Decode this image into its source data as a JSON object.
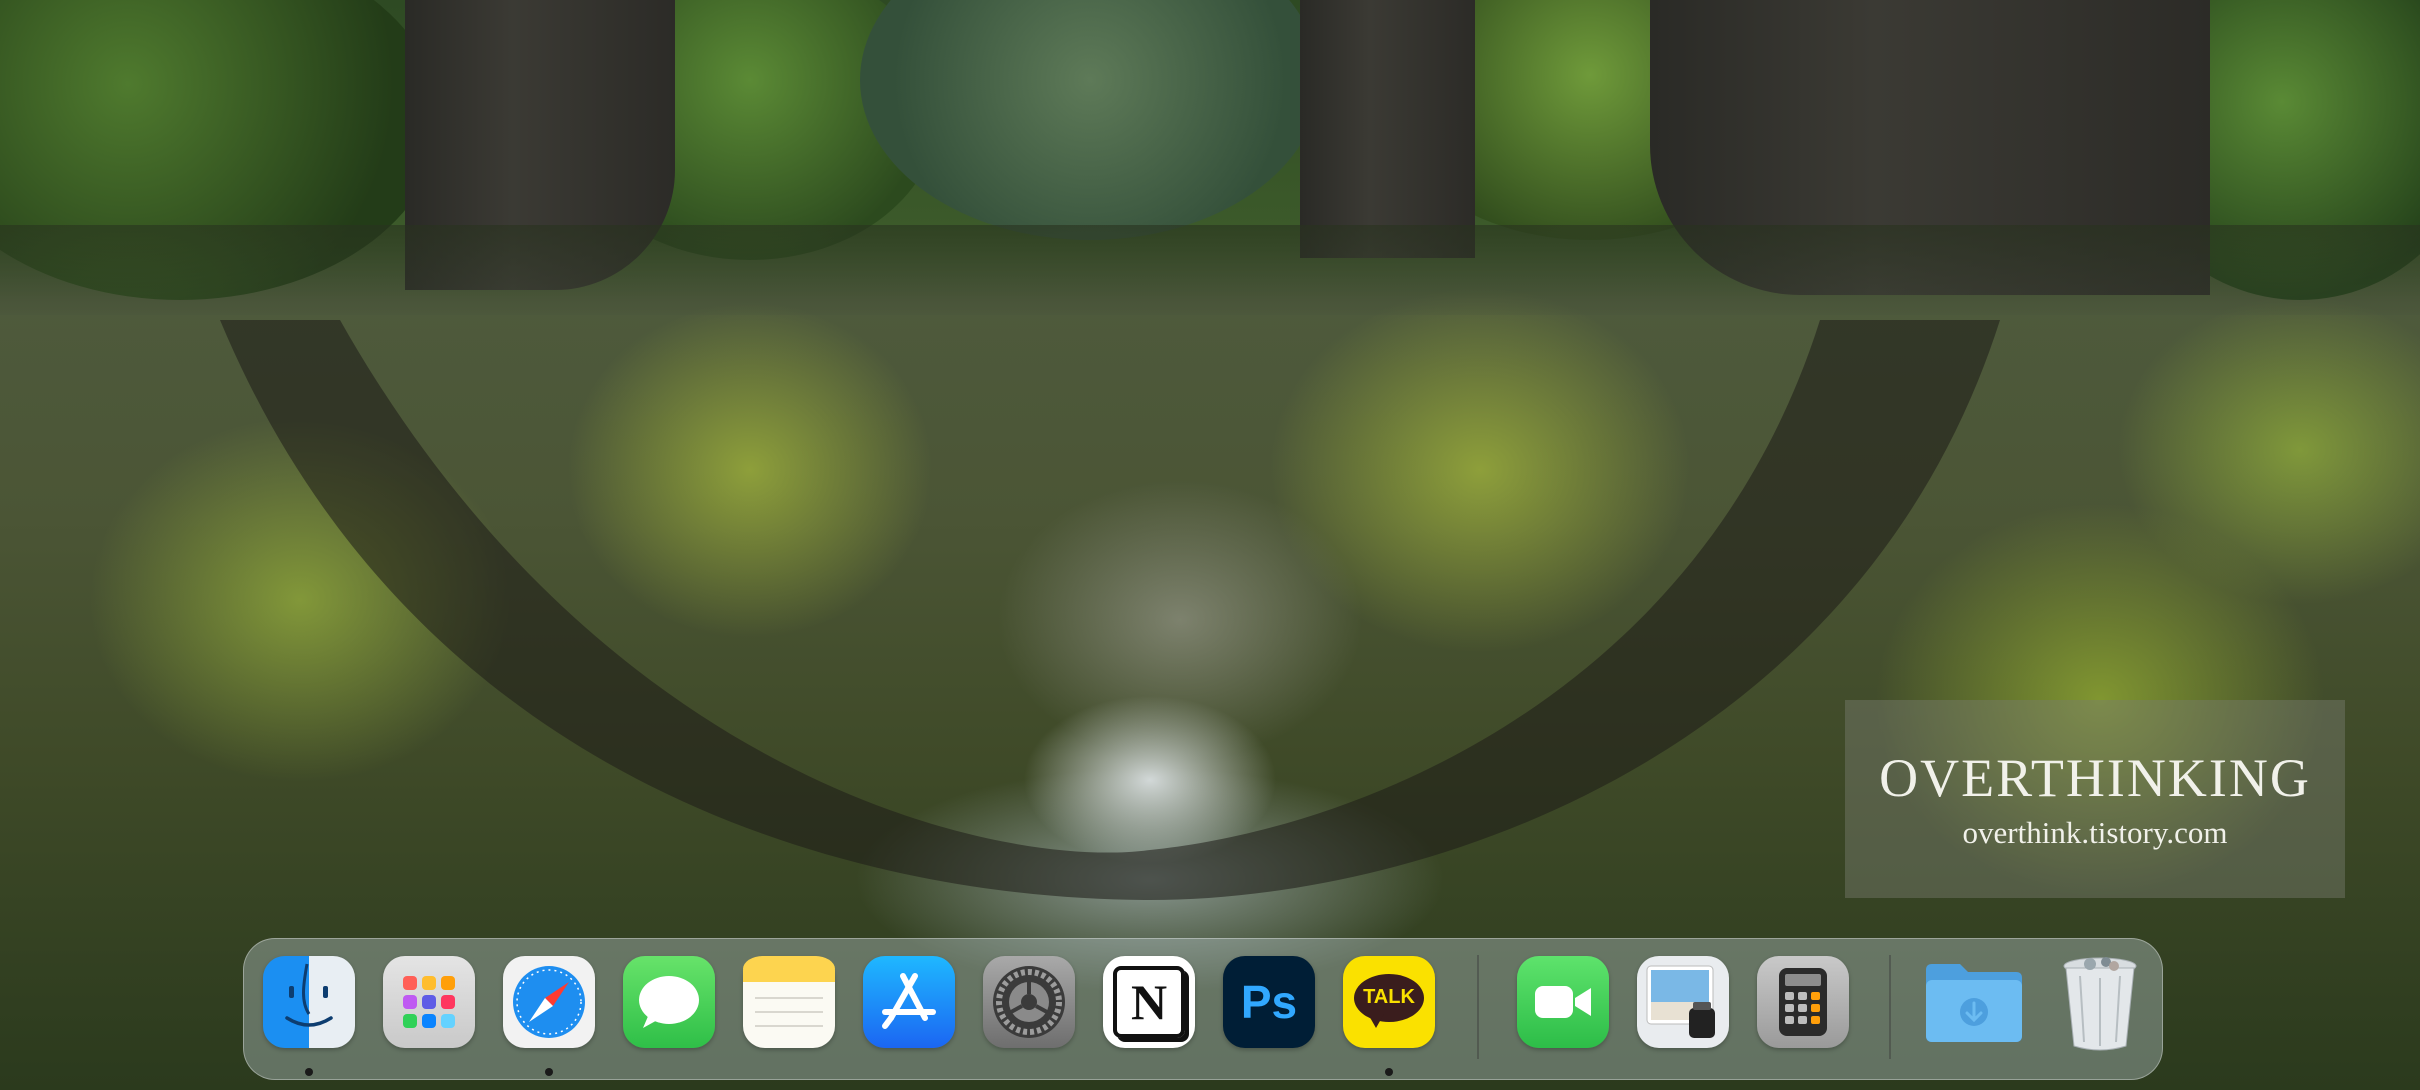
{
  "watermark": {
    "title": "OVERTHINKING",
    "subtitle": "overthink.tistory.com"
  },
  "dock": {
    "apps": [
      {
        "name": "Finder",
        "icon": "finder-icon",
        "running": true
      },
      {
        "name": "Launchpad",
        "icon": "launchpad-icon",
        "running": false
      },
      {
        "name": "Safari",
        "icon": "safari-icon",
        "running": true
      },
      {
        "name": "Messages",
        "icon": "messages-icon",
        "running": false
      },
      {
        "name": "Notes",
        "icon": "notes-icon",
        "running": false
      },
      {
        "name": "App Store",
        "icon": "app-store-icon",
        "running": false
      },
      {
        "name": "System Preferences",
        "icon": "system-preferences-icon",
        "running": false
      },
      {
        "name": "Notion",
        "icon": "notion-icon",
        "running": false,
        "glyph": "N"
      },
      {
        "name": "Photoshop",
        "icon": "photoshop-icon",
        "running": false,
        "glyph": "Ps"
      },
      {
        "name": "KakaoTalk",
        "icon": "kakaotalk-icon",
        "running": true,
        "glyph": "TALK"
      },
      {
        "name": "FaceTime",
        "icon": "facetime-icon",
        "running": false
      },
      {
        "name": "Preview",
        "icon": "preview-icon",
        "running": false
      },
      {
        "name": "Calculator",
        "icon": "calculator-icon",
        "running": false
      },
      {
        "name": "Downloads",
        "icon": "downloads-folder-icon",
        "running": false
      },
      {
        "name": "Trash",
        "icon": "trash-icon",
        "running": false
      }
    ]
  },
  "colors": {
    "safari_blue": "#1e8ef0",
    "messages_green": "#34c759",
    "appstore_blue": "#1b7cf2",
    "photoshop_navy": "#001e36",
    "photoshop_text": "#31a8ff",
    "kakao_yellow": "#fae100",
    "kakao_brown": "#3a1d1d",
    "folder_blue": "#5aaeea"
  }
}
